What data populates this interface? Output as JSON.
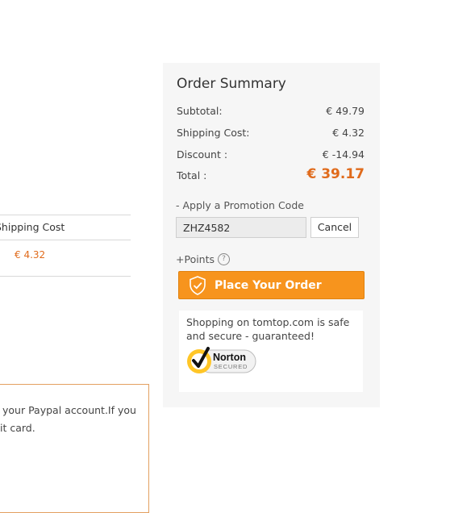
{
  "shipping_table": {
    "header": "Shipping Cost",
    "value": "€ 4.32"
  },
  "paypal_note": {
    "line1": "your Paypal account.If you",
    "line2": "it card."
  },
  "summary": {
    "title": "Order Summary",
    "subtotal_label": "Subtotal:",
    "subtotal_value": "€ 49.79",
    "shipping_label": "Shipping Cost:",
    "shipping_value": "€ 4.32",
    "discount_label": "Discount :",
    "discount_value": "€  -14.94",
    "total_label": "Total :",
    "total_value": "€  39.17",
    "promo_label": "- Apply a Promotion Code",
    "promo_value": "ZHZ4582",
    "cancel_label": "Cancel",
    "points_label": "+Points",
    "help_icon_glyph": "?",
    "place_order_label": "Place Your Order",
    "secure_text": "Shopping on tomtop.com is safe and secure - guaranteed!",
    "norton_logo_text": "Norton",
    "norton_logo_sub": "SECURED"
  },
  "colors": {
    "accent": "#f7941d",
    "price": "#e06b1c"
  }
}
